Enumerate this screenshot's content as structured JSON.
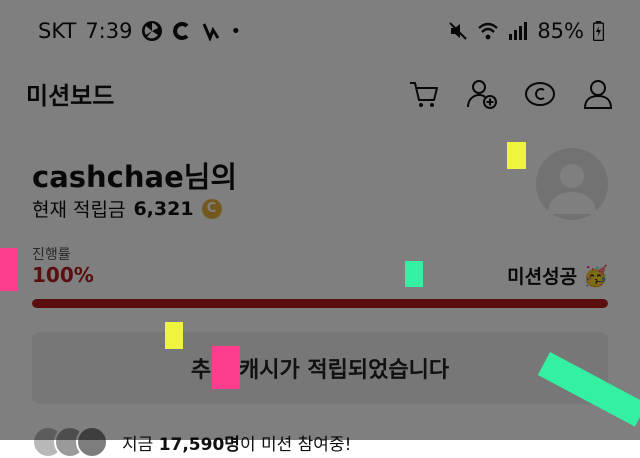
{
  "status_bar": {
    "carrier": "SKT",
    "time": "7:39",
    "battery": "85%"
  },
  "header": {
    "title": "미션보드",
    "icons": [
      "cart-icon",
      "add-friend-icon",
      "coin-icon",
      "profile-icon"
    ]
  },
  "profile": {
    "username": "cashchae님의",
    "balance_label": "현재 적립금",
    "balance_value": "6,321",
    "coin_symbol": "C"
  },
  "progress": {
    "caption": "진행률",
    "value_text": "100%",
    "percent": 100,
    "status_label": "미션성공",
    "status_emoji": "🥳",
    "color": "#b51d1d"
  },
  "notice": {
    "text": "추가 캐시가 적립되었습니다"
  },
  "participants": {
    "prefix": "지금",
    "count": "17,590명",
    "suffix": "이 미션 참여중!"
  },
  "colors": {
    "dim_overlay": "rgba(0,0,0,0.5)",
    "confetti_pink": "#ff3d8f",
    "confetti_yellow": "#eef53c",
    "confetti_green": "#34f0a2"
  }
}
